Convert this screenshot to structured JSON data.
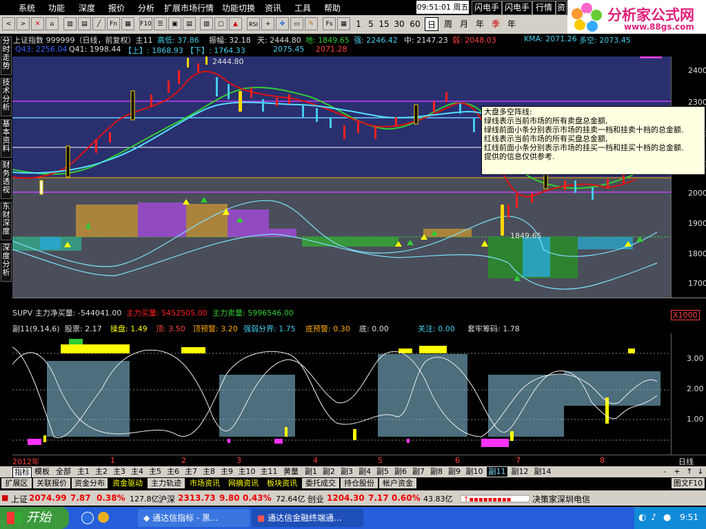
{
  "menu": {
    "items": [
      "系统",
      "功能",
      "深度",
      "报价",
      "分析",
      "扩展市场行情",
      "功能切换",
      "资讯",
      "工具",
      "帮助"
    ],
    "clock": "09:51:01",
    "weekday": "周五",
    "right_buttons": [
      "闪电手",
      "闪电手",
      "行情",
      "资"
    ]
  },
  "logo": {
    "title": "分析家公式网",
    "url": "www.88gs.com"
  },
  "toolbar": {
    "buttons": [
      "Fn",
      "F10",
      "Fs",
      "RSI"
    ],
    "periods": [
      "1",
      "5",
      "15",
      "30",
      "60",
      "日",
      "周",
      "月",
      "年",
      "季",
      "年"
    ]
  },
  "left_tabs": [
    "分时走势",
    "技术分析",
    "基本资料",
    "财务透视",
    "东财深度",
    "深度分析"
  ],
  "main_header": {
    "line1": "上证指数  999999（日线，前复权）主11",
    "low_label": "高低: 37.86",
    "amp_label": "振幅: 32.18",
    "tian": "天: 2444.80",
    "di": "地: 1849.65",
    "qiang": "强: 2246.42",
    "zhong": "中: 2147.23",
    "ruo": "弱: 2048.03",
    "kma": "KMA: 2071.26",
    "duo": "多空: 2073.45",
    "line2_a": "Q43: 2256.04",
    "line2_b": "Q41: 1998.44",
    "line2_c": "【上】: 1868.93",
    "line2_d": "【下】: 1764.33",
    "line2_e": "2075.45",
    "line2_f": "2071.28"
  },
  "main_chart": {
    "high_label": "2444.80",
    "low_label": "1849.65",
    "y_ticks": [
      "2400",
      "2300",
      "2200",
      "2100",
      "2000",
      "1900",
      "1800",
      "1700"
    ]
  },
  "tooltip": {
    "title": "大盘多空阵线:",
    "lines": [
      "绿线表示当前市场的所有卖盘总金额,",
      "绿线前面小条分别表示市场的挂卖一档和挂卖十档的总金额.",
      "红线表示当前市场的所有买盘总金额,",
      "红线前面小条分别表示市场的挂买一档和挂买十档的总金额.",
      "提供的信息仅供参考."
    ]
  },
  "supv": {
    "label": "SUPV 主力净买量: -544041.00",
    "buy": "主力买量: 5452505.00",
    "sell": "主力卖量: 5996546.00",
    "scale": "X1000"
  },
  "sub_header": {
    "name": "副11(9,14,6)",
    "a": "股票: 2.17",
    "b": "操盘: 1.49",
    "c": "顶: 3.50",
    "d": "顶预警: 3.20",
    "e": "强弱分界: 1.75",
    "f": "底预警: 0.30",
    "g": "底: 0.00",
    "h": "关注: 0.00",
    "i": "套牢筹码: 1.78"
  },
  "sub_chart": {
    "y_ticks": [
      "3.00",
      "2.00",
      "1.00"
    ]
  },
  "x_axis": {
    "labels": [
      "2012年",
      "1",
      "2",
      "3",
      "4",
      "5",
      "6",
      "7",
      "8"
    ],
    "period": "日线"
  },
  "bottom_tabs": [
    "指标",
    "模板",
    "全部",
    "主1",
    "主2",
    "主3",
    "主4",
    "主5",
    "主6",
    "主7",
    "主8",
    "主9",
    "主10",
    "主11",
    "黄量",
    "副1",
    "副2",
    "副3",
    "副4",
    "副5",
    "副6",
    "副7",
    "副8",
    "副9",
    "副10",
    "副11",
    "副12",
    "副14"
  ],
  "sec_tabs": [
    "扩展区",
    "关联报价",
    "资金分布",
    "资金驱动",
    "主力轨迹",
    "市场资讯",
    "网摘资讯",
    "板块资讯",
    "委托成交",
    "持仓股份",
    "帐户资金"
  ],
  "sec_tabs_right": "图文F10",
  "ticker": {
    "sh_label": "上证",
    "sh_value": "2074.99",
    "sh_change": "7.87",
    "sh_pct": "0.38%",
    "sh_amount": "127.8亿",
    "sz_label": "沪深",
    "sz_value": "2313.73",
    "sz_change": "9.80",
    "sz_pct": "0.43%",
    "sz_amount": "72.64亿",
    "cy_label": "创业",
    "cy_value": "1204.30",
    "cy_change": "7.17",
    "cy_pct": "0.60%",
    "cy_amount": "43.83亿",
    "broker": "决策家深圳电信"
  },
  "taskbar": {
    "start": "开始",
    "tasks": [
      "通达信指标 - 黑...",
      "通达信金融终端通..."
    ],
    "time": "9:51"
  },
  "colors": {
    "main_bg": "#2a2f6e",
    "lower_bg": "#4a4e5a",
    "red": "#ff2020",
    "green": "#33cc33",
    "cyan": "#44ccee",
    "yellow": "#ffff00",
    "magenta": "#ff44ff"
  }
}
